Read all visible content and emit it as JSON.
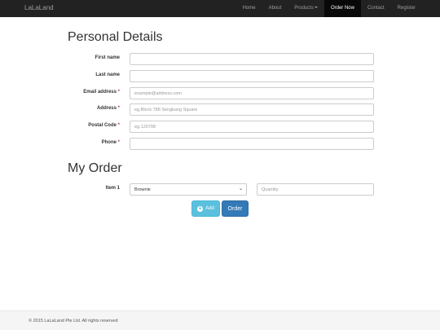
{
  "navbar": {
    "brand": "LaLaLand",
    "items": [
      {
        "label": "Home"
      },
      {
        "label": "About"
      },
      {
        "label": "Products"
      },
      {
        "label": "Order Now"
      },
      {
        "label": "Contact"
      },
      {
        "label": "Register"
      }
    ]
  },
  "personal": {
    "title": "Personal Details",
    "fields": [
      {
        "label": "First name",
        "required": "",
        "placeholder": ""
      },
      {
        "label": "Last name",
        "required": "",
        "placeholder": ""
      },
      {
        "label": "Email address",
        "required": "*",
        "placeholder": "example@address.com"
      },
      {
        "label": "Address",
        "required": "*",
        "placeholder": "eg.Block 788 Sengkang Square"
      },
      {
        "label": "Postal Code",
        "required": "*",
        "placeholder": "eg.120708"
      },
      {
        "label": "Phone",
        "required": "*",
        "placeholder": ""
      }
    ]
  },
  "order": {
    "title": "My Order",
    "item_label": "Item 1",
    "item_value": "Brownie",
    "quantity_placeholder": "Quantity",
    "add_label": "Add",
    "order_label": "Order"
  },
  "footer": {
    "text": "© 2015 LaLaLand Pte Ltd. All rights reserved"
  }
}
